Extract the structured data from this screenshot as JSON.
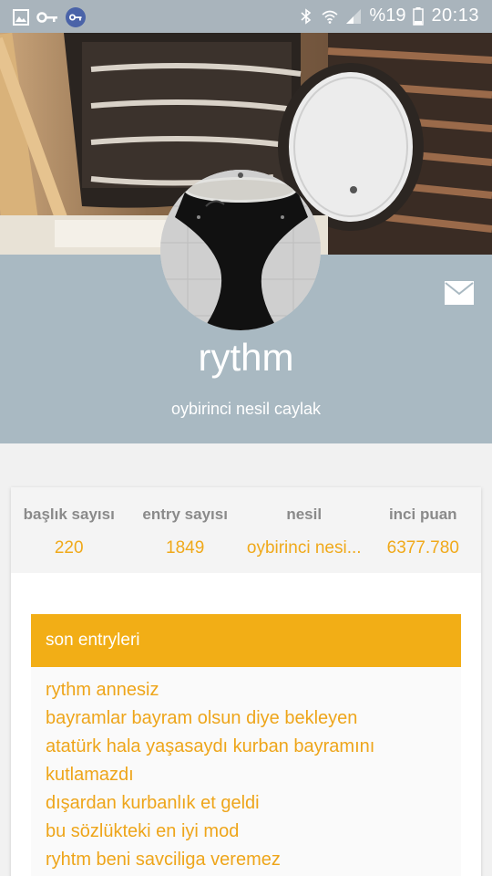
{
  "status_bar": {
    "left_icons": [
      "image-icon",
      "key-icon",
      "vpn-key-icon"
    ],
    "right_icons": [
      "bluetooth-icon",
      "wifi-icon",
      "signal-icon"
    ],
    "battery_text": "%19",
    "time": "20:13"
  },
  "profile": {
    "username": "rythm",
    "generation": "oybirinci nesil caylak"
  },
  "stats": [
    {
      "label": "başlık sayısı",
      "value": "220"
    },
    {
      "label": "entry sayısı",
      "value": "1849"
    },
    {
      "label": "nesil",
      "value": "oybirinci nesi..."
    },
    {
      "label": "inci puan",
      "value": "6377.780"
    }
  ],
  "recent": {
    "title": "son entryleri",
    "items": [
      "rythm annesiz",
      "bayramlar bayram olsun diye bekleyen",
      "atatürk hala yaşasaydı kurban bayramını kutlamazdı",
      "dışardan kurbanlık et geldi",
      "bu sözlükteki en iyi mod",
      "ryhtm beni savciliga veremez"
    ]
  },
  "colors": {
    "accent": "#f2ae16",
    "band": "#a9b9c2",
    "status_bar": "#a9b4bc"
  }
}
